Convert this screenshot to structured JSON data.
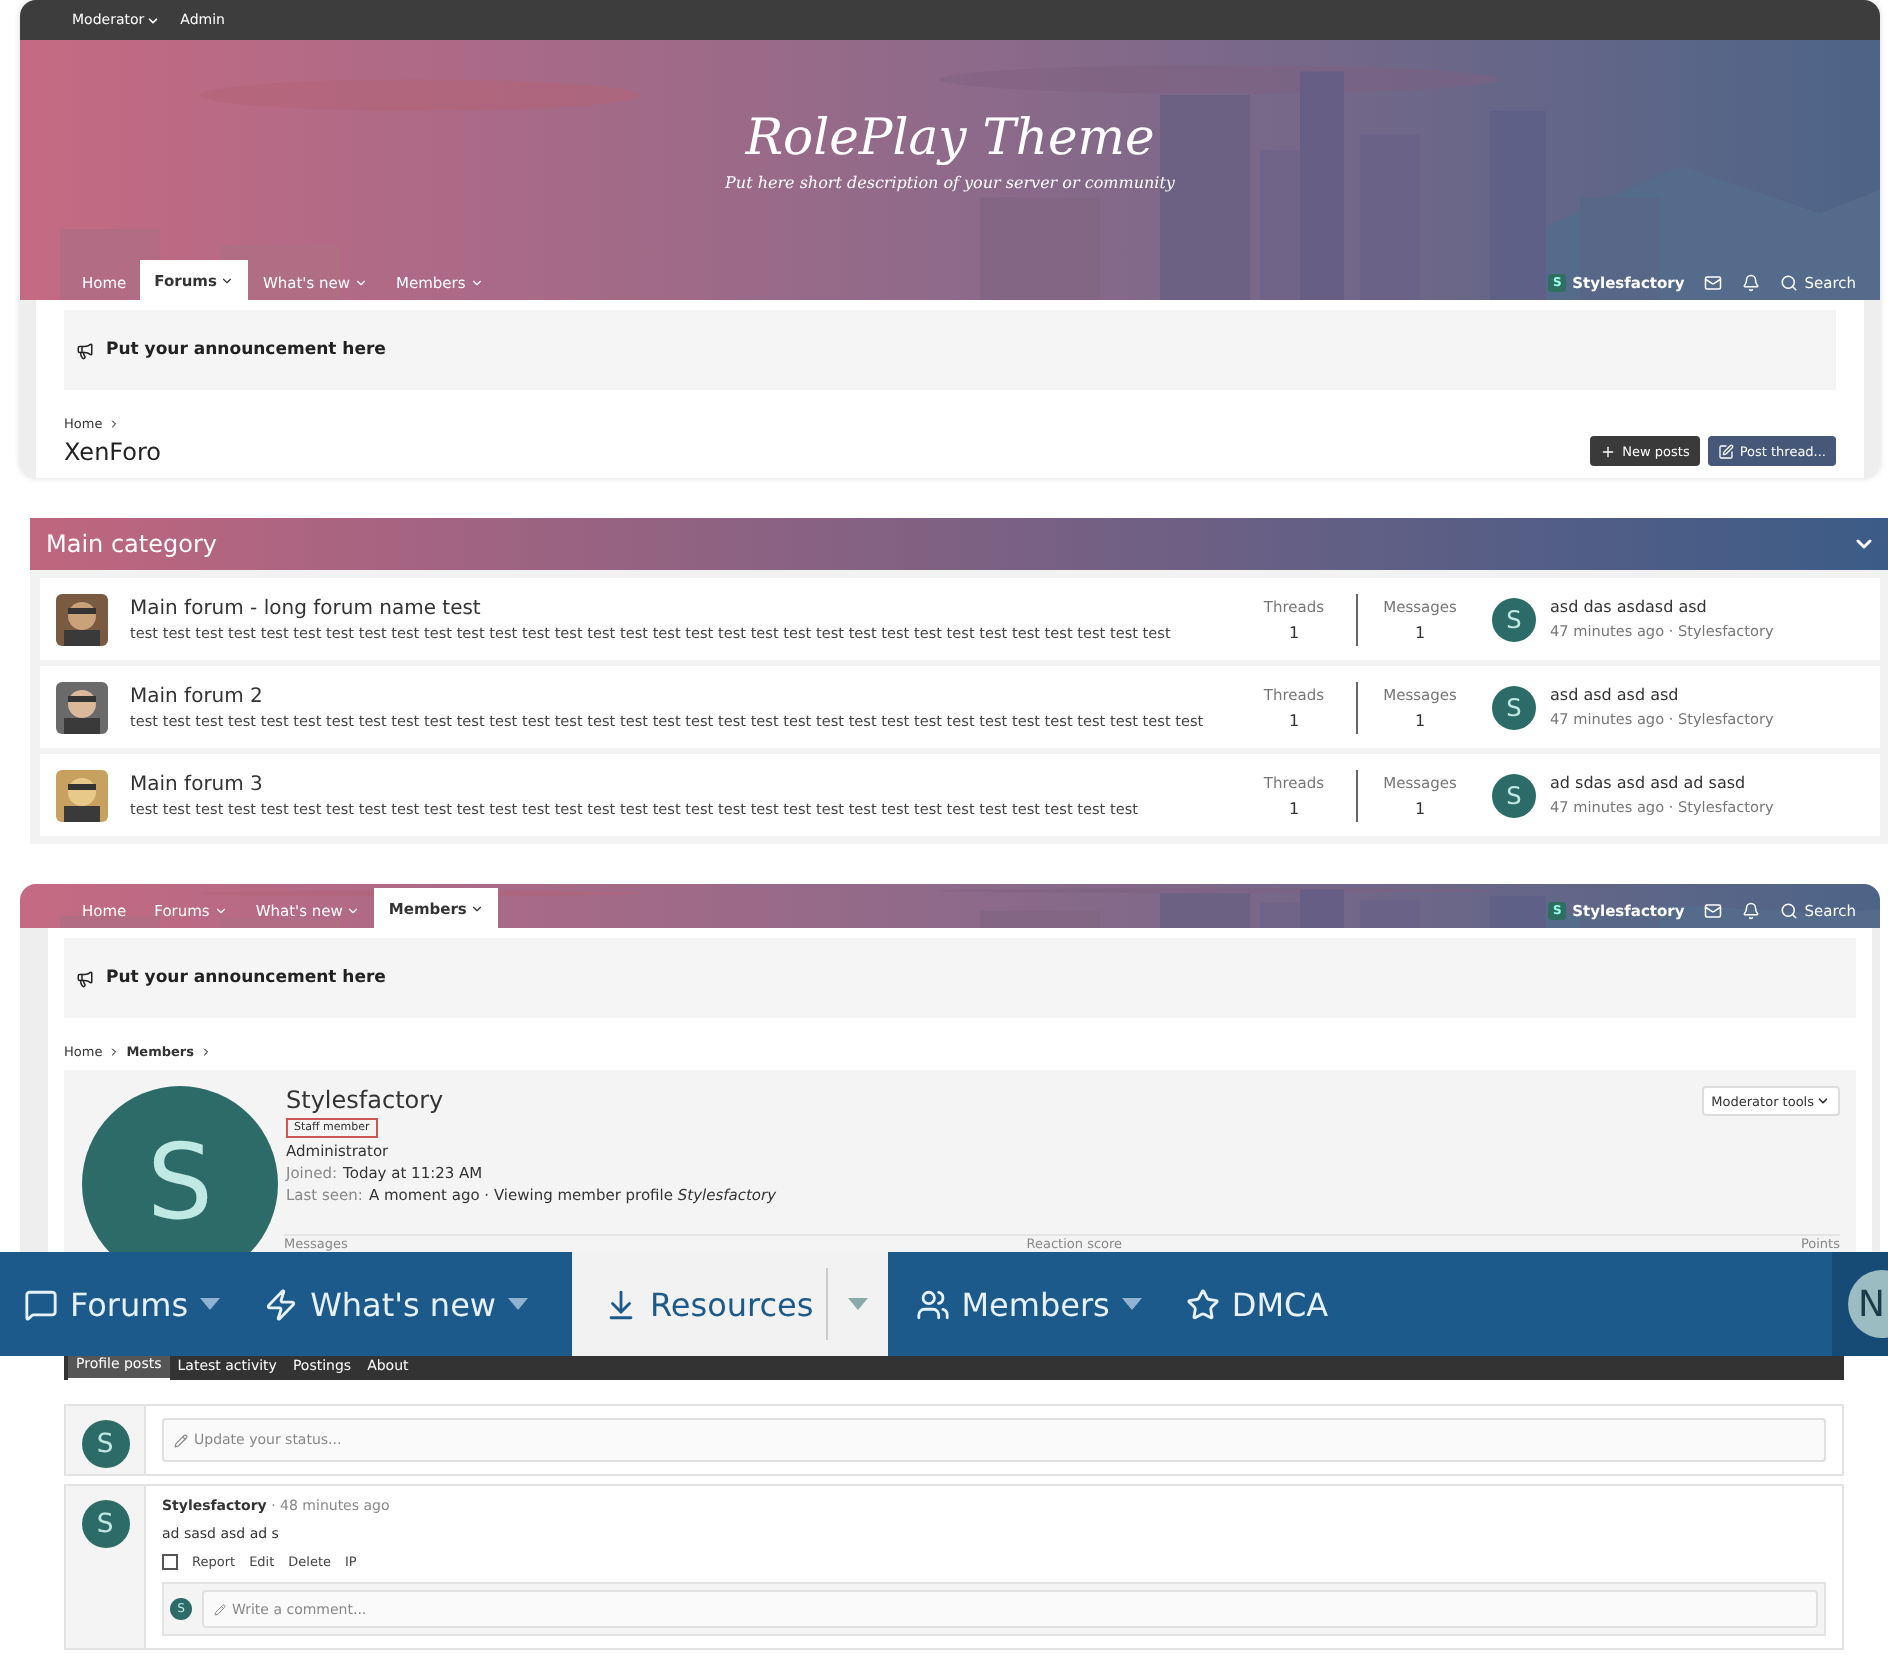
{
  "staff_bar": [
    {
      "label": "Moderator",
      "dropdown": true
    },
    {
      "label": "Admin",
      "dropdown": false
    }
  ],
  "header": {
    "title": "RolePlay Theme",
    "description": "Put here short description of your server or community"
  },
  "nav": {
    "tabs": [
      {
        "label": "Home",
        "selected": false,
        "dropdown": false
      },
      {
        "label": "Forums",
        "selected": true,
        "dropdown": true
      },
      {
        "label": "What's new",
        "selected": false,
        "dropdown": true
      },
      {
        "label": "Members",
        "selected": false,
        "dropdown": true
      }
    ],
    "user_initial": "S",
    "user": "Stylesfactory",
    "search": "Search"
  },
  "notice": "Put your announcement here",
  "breadcrumb": [
    "Home"
  ],
  "page_title": "XenForo",
  "buttons": [
    {
      "label": "New posts",
      "kind": "new"
    },
    {
      "label": "Post thread...",
      "kind": "post"
    }
  ],
  "category": {
    "title": "Main category",
    "expanded": true,
    "forums": [
      {
        "title": "Main forum - long forum name test",
        "description": "test test test test test test test test test test test test test test test test test test test test test test test test test test test test test test test test",
        "threads_label": "Threads",
        "threads": "1",
        "messages_label": "Messages",
        "messages": "1",
        "last_initial": "S",
        "last_title": "asd das asdasd asd",
        "last_meta": "47 minutes ago · Stylesfactory"
      },
      {
        "title": "Main forum 2",
        "description": "test test test test test test test test test test test test test test test test test test test test test test test test test test test test test test test test test",
        "threads_label": "Threads",
        "threads": "1",
        "messages_label": "Messages",
        "messages": "1",
        "last_initial": "S",
        "last_title": "asd asd asd asd",
        "last_meta": "47 minutes ago · Stylesfactory"
      },
      {
        "title": "Main forum 3",
        "description": "test test test test test test test test test test test test test test test test test test test test test test test test test test test test test test test",
        "threads_label": "Threads",
        "threads": "1",
        "messages_label": "Messages",
        "messages": "1",
        "last_initial": "S",
        "last_title": "ad sdas asd asd ad sasd",
        "last_meta": "47 minutes ago · Stylesfactory"
      }
    ]
  },
  "profile_header": {
    "nav": {
      "tabs": [
        {
          "label": "Home",
          "selected": false,
          "dropdown": false
        },
        {
          "label": "Forums",
          "selected": false,
          "dropdown": true
        },
        {
          "label": "What's new",
          "selected": false,
          "dropdown": true
        },
        {
          "label": "Members",
          "selected": true,
          "dropdown": true
        }
      ],
      "user_initial": "S",
      "user": "Stylesfactory",
      "search": "Search"
    },
    "notice": "Put your announcement here",
    "breadcrumb": [
      "Home",
      "Members"
    ],
    "member": {
      "initial": "S",
      "name": "Stylesfactory",
      "badge": "Staff member",
      "role": "Administrator",
      "joined_label": "Joined:",
      "joined": "Today at 11:23 AM",
      "last_seen_label": "Last seen:",
      "last_seen": "A moment ago · Viewing member profile *Stylesfactory*",
      "tools": "Moderator tools",
      "stats": [
        "Messages",
        "Reaction score",
        "Points"
      ]
    }
  },
  "site_nav": {
    "tabs": [
      {
        "label": "Forums",
        "selected": false,
        "dropdown": true
      },
      {
        "label": "What's new",
        "selected": false,
        "dropdown": true
      },
      {
        "label": "Resources",
        "selected": true,
        "dropdown": true
      },
      {
        "label": "Members",
        "selected": false,
        "dropdown": true
      },
      {
        "label": "DMCA",
        "selected": false,
        "dropdown": false
      }
    ],
    "avatar_initial": "N"
  },
  "profile_content": {
    "tabs": [
      {
        "label": "Profile posts",
        "selected": true
      },
      {
        "label": "Latest activity",
        "selected": false
      },
      {
        "label": "Postings",
        "selected": false
      },
      {
        "label": "About",
        "selected": false
      }
    ],
    "status_initial": "S",
    "status_placeholder": "Update your status...",
    "posts": [
      {
        "initial": "S",
        "author": "Stylesfactory",
        "time": "· 48 minutes ago",
        "text": "ad sasd asd ad s",
        "checked": false,
        "actions": [
          "Report",
          "Edit",
          "Delete",
          "IP"
        ],
        "comment_initial": "S",
        "comment_placeholder": "Write a comment..."
      }
    ]
  }
}
